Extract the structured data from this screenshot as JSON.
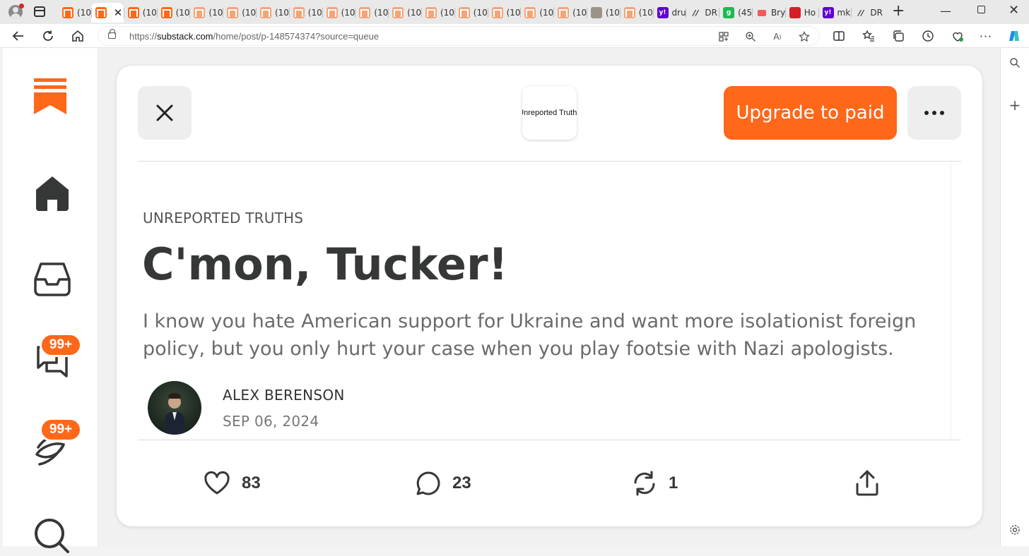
{
  "browser": {
    "tabs": [
      {
        "label": "(10",
        "icon": "substack-favicon",
        "active": false
      },
      {
        "label": "",
        "icon": "substack-favicon",
        "active": true
      },
      {
        "label": "(10",
        "icon": "substack-favicon",
        "active": false
      },
      {
        "label": "(10",
        "icon": "substack-favicon",
        "active": false
      },
      {
        "label": "(10",
        "icon": "substack-favicon-faded",
        "active": false
      },
      {
        "label": "(10",
        "icon": "substack-favicon-faded",
        "active": false
      },
      {
        "label": "(10",
        "icon": "substack-favicon-faded",
        "active": false
      },
      {
        "label": "(10",
        "icon": "substack-favicon-faded",
        "active": false
      },
      {
        "label": "(10",
        "icon": "substack-favicon-faded",
        "active": false
      },
      {
        "label": "(10",
        "icon": "substack-favicon-faded",
        "active": false
      },
      {
        "label": "(10",
        "icon": "substack-favicon-faded",
        "active": false
      },
      {
        "label": "(10",
        "icon": "substack-favicon-faded",
        "active": false
      },
      {
        "label": "(10",
        "icon": "substack-favicon-faded",
        "active": false
      },
      {
        "label": "(10",
        "icon": "substack-favicon-faded",
        "active": false
      },
      {
        "label": "(10",
        "icon": "substack-favicon-faded",
        "active": false
      },
      {
        "label": "(10",
        "icon": "substack-favicon-faded",
        "active": false
      },
      {
        "label": "(10",
        "icon": "photo-favicon",
        "active": false
      },
      {
        "label": "(10",
        "icon": "substack-favicon-faded",
        "active": false
      },
      {
        "label": "dru",
        "icon": "yahoo-favicon",
        "active": false
      },
      {
        "label": "DR",
        "icon": "drudge-favicon",
        "active": false
      },
      {
        "label": "(45",
        "icon": "g-favicon",
        "active": false
      },
      {
        "label": "Bry",
        "icon": "youtube-favicon",
        "active": false
      },
      {
        "label": "Ho",
        "icon": "red-favicon",
        "active": false
      },
      {
        "label": "mk",
        "icon": "yahoo-favicon",
        "active": false
      },
      {
        "label": "DR",
        "icon": "drudge-favicon",
        "active": false
      }
    ],
    "url_prefix": "https://",
    "url_domain": "substack.com",
    "url_path": "/home/post/p-148574374?source=queue"
  },
  "rail": {
    "notifications_badge": "99+",
    "activity_badge": "99+"
  },
  "post": {
    "publication_logo_text": "Unreported Truths",
    "upgrade_label": "Upgrade to paid",
    "kicker": "UNREPORTED TRUTHS",
    "title": "C'mon, Tucker!",
    "subtitle": "I know you hate American support for Ukraine and want more isolationist foreign policy, but you only hurt your case when you play footsie with Nazi apologists.",
    "author": "ALEX BERENSON",
    "date": "SEP 06, 2024",
    "likes": "83",
    "comments": "23",
    "restacks": "1"
  },
  "colors": {
    "accent": "#ff6719",
    "title": "#363737",
    "subtitle": "#6b6b6b"
  }
}
